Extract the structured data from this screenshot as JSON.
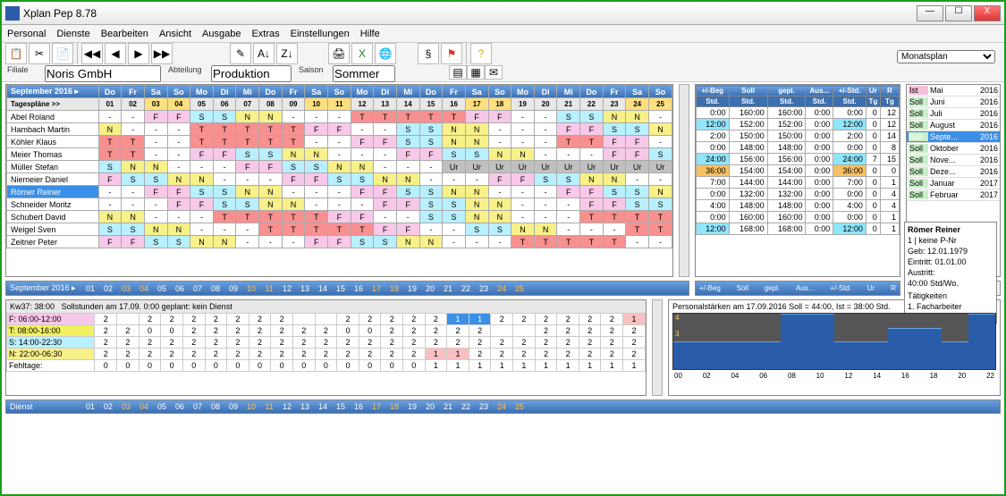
{
  "window": {
    "title": "Xplan Pep 8.78",
    "min": "—",
    "max": "☐",
    "close": "X"
  },
  "menu": [
    "Personal",
    "Dienste",
    "Bearbeiten",
    "Ansicht",
    "Ausgabe",
    "Extras",
    "Einstellungen",
    "Hilfe"
  ],
  "fields": {
    "filiale_label": "Filiale",
    "filiale": "Noris GmbH",
    "abteilung_label": "Abteilung",
    "abteilung": "Produktion",
    "saison_label": "Saison",
    "saison": "Sommer"
  },
  "view_select": "Monatsplan",
  "calendar": {
    "month": "September 2016",
    "tagesplaene": "Tagespläne >>",
    "day_abbr": [
      "Do",
      "Fr",
      "Sa",
      "So",
      "Mo",
      "Di",
      "Mi",
      "Do",
      "Fr",
      "Sa",
      "So",
      "Mo",
      "Di",
      "Mi",
      "Do",
      "Fr",
      "Sa",
      "So",
      "Mo",
      "Di",
      "Mi",
      "Do",
      "Fr",
      "Sa",
      "So"
    ],
    "dates": [
      "01",
      "02",
      "03",
      "04",
      "05",
      "06",
      "07",
      "08",
      "09",
      "10",
      "11",
      "12",
      "13",
      "14",
      "15",
      "16",
      "17",
      "18",
      "19",
      "20",
      "21",
      "22",
      "23",
      "24",
      "25"
    ],
    "weekend_idx": [
      2,
      3,
      9,
      10,
      16,
      17,
      23,
      24
    ],
    "rows": [
      {
        "name": "Abel Roland",
        "shifts": [
          "-",
          "-",
          "F",
          "F",
          "S",
          "S",
          "N",
          "N",
          "-",
          "-",
          "-",
          "T",
          "T",
          "T",
          "T",
          "T",
          "F",
          "F",
          "-",
          "-",
          "S",
          "S",
          "N",
          "N",
          "-"
        ]
      },
      {
        "name": "Hambach Martin",
        "shifts": [
          "N",
          "-",
          "-",
          "-",
          "T",
          "T",
          "T",
          "T",
          "T",
          "F",
          "F",
          "-",
          "-",
          "S",
          "S",
          "N",
          "N",
          "-",
          "-",
          "-",
          "F",
          "F",
          "S",
          "S",
          "N"
        ]
      },
      {
        "name": "Köhler Klaus",
        "shifts": [
          "T",
          "T",
          "-",
          "-",
          "T",
          "T",
          "T",
          "T",
          "T",
          "-",
          "-",
          "F",
          "F",
          "S",
          "S",
          "N",
          "N",
          "-",
          "-",
          "-",
          "T",
          "T",
          "F",
          "F",
          "-"
        ]
      },
      {
        "name": "Meier Thomas",
        "shifts": [
          "T",
          "T",
          "-",
          "-",
          "F",
          "F",
          "S",
          "S",
          "N",
          "N",
          "-",
          "-",
          "-",
          "F",
          "F",
          "S",
          "S",
          "N",
          "N",
          "-",
          "-",
          "-",
          "F",
          "F",
          "S"
        ]
      },
      {
        "name": "Müller Stefan",
        "shifts": [
          "S",
          "N",
          "N",
          "-",
          "-",
          "-",
          "F",
          "F",
          "S",
          "S",
          "N",
          "N",
          "-",
          "-",
          "-",
          "Ur",
          "Ur",
          "Ur",
          "Ur",
          "Ur",
          "Ur",
          "Ur",
          "Ur",
          "Ur",
          "Ur"
        ]
      },
      {
        "name": "Niemeier Daniel",
        "shifts": [
          "F",
          "S",
          "S",
          "N",
          "N",
          "-",
          "-",
          "-",
          "F",
          "F",
          "S",
          "S",
          "N",
          "N",
          "-",
          "-",
          "-",
          "F",
          "F",
          "S",
          "S",
          "N",
          "N",
          "-",
          "-"
        ]
      },
      {
        "name": "Römer Reiner",
        "sel": true,
        "shifts": [
          "-",
          "-",
          "F",
          "F",
          "S",
          "S",
          "N",
          "N",
          "-",
          "-",
          "-",
          "F",
          "F",
          "S",
          "S",
          "N",
          "N",
          "-",
          "-",
          "-",
          "F",
          "F",
          "S",
          "S",
          "N"
        ]
      },
      {
        "name": "Schneider Moritz",
        "shifts": [
          "-",
          "-",
          "-",
          "F",
          "F",
          "S",
          "S",
          "N",
          "N",
          "-",
          "-",
          "-",
          "F",
          "F",
          "S",
          "S",
          "N",
          "N",
          "-",
          "-",
          "-",
          "F",
          "F",
          "S",
          "S"
        ]
      },
      {
        "name": "Schubert David",
        "shifts": [
          "N",
          "N",
          "-",
          "-",
          "-",
          "T",
          "T",
          "T",
          "T",
          "T",
          "F",
          "F",
          "-",
          "-",
          "S",
          "S",
          "N",
          "N",
          "-",
          "-",
          "-",
          "T",
          "T",
          "T",
          "T"
        ]
      },
      {
        "name": "Weigel Sven",
        "shifts": [
          "S",
          "S",
          "N",
          "N",
          "-",
          "-",
          "-",
          "T",
          "T",
          "T",
          "T",
          "T",
          "F",
          "F",
          "-",
          "-",
          "S",
          "S",
          "N",
          "N",
          "-",
          "-",
          "-",
          "T",
          "T"
        ]
      },
      {
        "name": "Zeitner Peter",
        "shifts": [
          "F",
          "F",
          "S",
          "S",
          "N",
          "N",
          "-",
          "-",
          "-",
          "F",
          "F",
          "S",
          "S",
          "N",
          "N",
          "-",
          "-",
          "-",
          "T",
          "T",
          "T",
          "T",
          "T",
          "-",
          "-"
        ]
      }
    ]
  },
  "summary": {
    "headers": [
      "+/-Beg",
      "Soll",
      "gepl.",
      "Aus...",
      "+/-Std.",
      "Ur",
      "R"
    ],
    "sub": [
      "Std.",
      "Std.",
      "Std.",
      "Std.",
      "Std.",
      "Tg",
      "Tg"
    ],
    "rows": [
      {
        "v": [
          "0:00",
          "160:00",
          "160:00",
          "0:00",
          "0:00",
          "0",
          "12"
        ]
      },
      {
        "v": [
          "12:00",
          "152:00",
          "152:00",
          "0:00",
          "12:00",
          "0",
          "12"
        ],
        "hl": [
          0,
          4
        ]
      },
      {
        "v": [
          "2:00",
          "150:00",
          "150:00",
          "0:00",
          "2:00",
          "0",
          "14"
        ]
      },
      {
        "v": [
          "0:00",
          "148:00",
          "148:00",
          "0:00",
          "0:00",
          "0",
          "8"
        ]
      },
      {
        "v": [
          "24:00",
          "156:00",
          "156:00",
          "0:00",
          "24:00",
          "7",
          "15"
        ],
        "hl": [
          0,
          4
        ]
      },
      {
        "v": [
          "36:00",
          "154:00",
          "154:00",
          "0:00",
          "36:00",
          "0",
          "0"
        ],
        "hlOr": [
          0,
          4
        ]
      },
      {
        "v": [
          "7:00",
          "144:00",
          "144:00",
          "0:00",
          "7:00",
          "0",
          "1"
        ]
      },
      {
        "v": [
          "0:00",
          "132:00",
          "132:00",
          "0:00",
          "0:00",
          "0",
          "4"
        ]
      },
      {
        "v": [
          "4:00",
          "148:00",
          "148:00",
          "0:00",
          "4:00",
          "0",
          "4"
        ]
      },
      {
        "v": [
          "0:00",
          "160:00",
          "160:00",
          "0:00",
          "0:00",
          "0",
          "1"
        ]
      },
      {
        "v": [
          "12:00",
          "168:00",
          "168:00",
          "0:00",
          "12:00",
          "0",
          "1"
        ],
        "hl": [
          0,
          4
        ]
      }
    ]
  },
  "months": [
    {
      "t": "Ist",
      "m": "Mai",
      "y": "2016",
      "ist": true
    },
    {
      "t": "Soll",
      "m": "Juni",
      "y": "2016"
    },
    {
      "t": "Soll",
      "m": "Juli",
      "y": "2016"
    },
    {
      "t": "Soll",
      "m": "August",
      "y": "2016"
    },
    {
      "t": "Soll",
      "m": "Septe...",
      "y": "2016",
      "sel": true
    },
    {
      "t": "Soll",
      "m": "Oktober",
      "y": "2016"
    },
    {
      "t": "Soll",
      "m": "Nove...",
      "y": "2016"
    },
    {
      "t": "Soll",
      "m": "Deze...",
      "y": "2016"
    },
    {
      "t": "Soll",
      "m": "Januar",
      "y": "2017"
    },
    {
      "t": "Soll",
      "m": "Februar",
      "y": "2017"
    }
  ],
  "info": {
    "name": "Römer Reiner",
    "pnr": "1 | keine P-Nr",
    "geb": "Geb: 12.01.1979",
    "eintritt": "Eintritt: 01.01.00",
    "austritt": "Austritt:",
    "std": "40:00 Std/Wo.",
    "taet_h": "Tätigkeiten",
    "taet": "1. Facharbeiter"
  },
  "kw": {
    "label": "Kw37: 38:00",
    "soll": "Sollstunden am 17.09.   0:00   geplant:   kein Dienst",
    "groups": [
      {
        "lbl": "F: 06:00-12:00",
        "cls": "lbl-F",
        "v": [
          "2",
          "",
          "2",
          "2",
          "2",
          "2",
          "2",
          "2",
          "2",
          "",
          "",
          "2",
          "2",
          "2",
          "2",
          "2",
          "1",
          "1",
          "2",
          "2",
          "2",
          "2",
          "2",
          "2",
          "1"
        ],
        "hl": [
          16,
          17
        ],
        "pink": [
          24
        ]
      },
      {
        "lbl": "T: 08:00-16:00",
        "cls": "lbl-T",
        "v": [
          "2",
          "2",
          "0",
          "0",
          "2",
          "2",
          "2",
          "2",
          "2",
          "2",
          "2",
          "0",
          "0",
          "2",
          "2",
          "2",
          "2",
          "2",
          "",
          "",
          "2",
          "2",
          "2",
          "2",
          "2"
        ],
        "pink": []
      },
      {
        "lbl": "S: 14:00-22:30",
        "cls": "lbl-S",
        "v": [
          "2",
          "2",
          "2",
          "2",
          "2",
          "2",
          "2",
          "2",
          "2",
          "2",
          "2",
          "2",
          "2",
          "2",
          "2",
          "2",
          "2",
          "2",
          "2",
          "2",
          "2",
          "2",
          "2",
          "2",
          "2"
        ],
        "pink": []
      },
      {
        "lbl": "N: 22:00-06:30",
        "cls": "lbl-N",
        "v": [
          "2",
          "2",
          "2",
          "2",
          "2",
          "2",
          "2",
          "2",
          "2",
          "2",
          "2",
          "2",
          "2",
          "2",
          "2",
          "1",
          "1",
          "2",
          "2",
          "2",
          "2",
          "2",
          "2",
          "2",
          "2"
        ],
        "pink": [
          15,
          16
        ]
      },
      {
        "lbl": "Fehltage:",
        "cls": "lbl-Fe",
        "v": [
          "0",
          "0",
          "0",
          "0",
          "0",
          "0",
          "0",
          "0",
          "0",
          "0",
          "0",
          "0",
          "0",
          "0",
          "0",
          "1",
          "1",
          "1",
          "1",
          "1",
          "1",
          "1",
          "1",
          "1",
          "1"
        ],
        "pink": []
      }
    ]
  },
  "chart_data": {
    "type": "bar",
    "title": "Personalstärken am 17.09.2016   Soll = 44:00, Ist = 38:00 Std.",
    "x": [
      "00",
      "02",
      "04",
      "06",
      "08",
      "10",
      "12",
      "14",
      "16",
      "18",
      "20",
      "22"
    ],
    "ylim": [
      0,
      4
    ],
    "values": [
      2,
      2,
      2,
      2,
      4,
      4,
      2,
      2,
      3,
      3,
      2,
      4
    ]
  },
  "dienst": {
    "label": "Dienst"
  }
}
